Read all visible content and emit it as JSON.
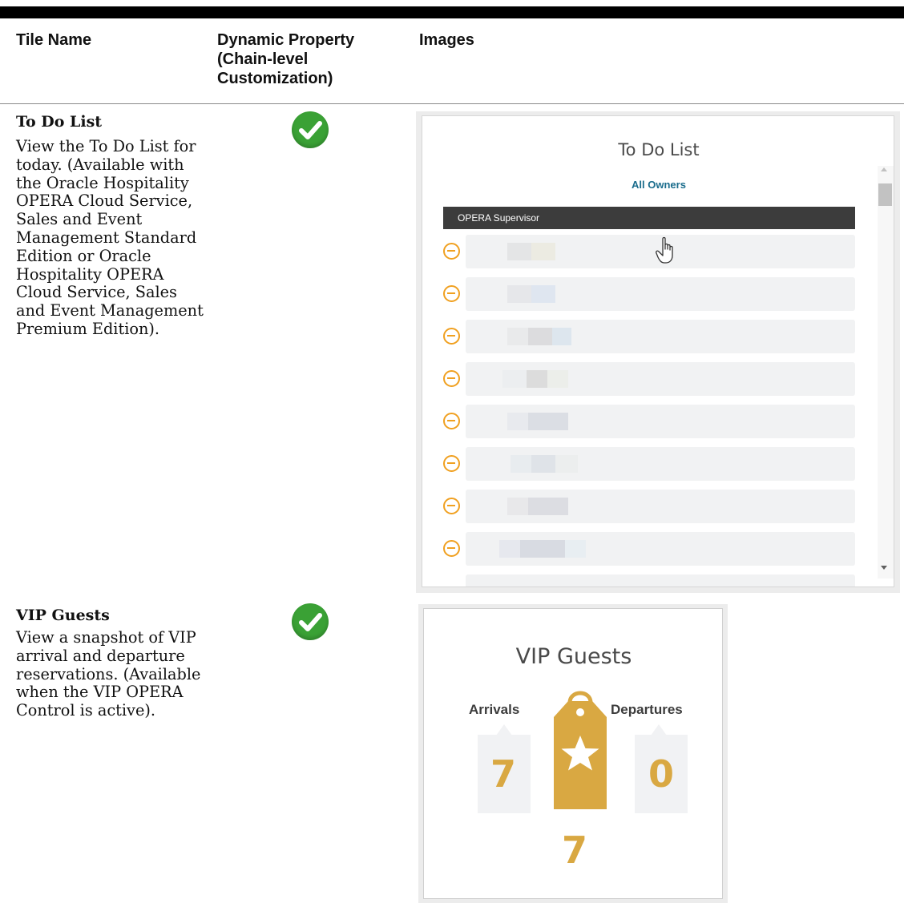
{
  "table": {
    "headers": {
      "tile_name": "Tile Name",
      "dynamic_property": "Dynamic Property (Chain-level Customization)",
      "images": "Images"
    },
    "rows": [
      {
        "title": "To Do List",
        "description": "View the To Do List for today. (Available with the Oracle Hospitality OPERA Cloud Service, Sales and Event Management Standard Edition or Oracle Hospitality OPERA Cloud Service, Sales and Event Management Premium Edition).",
        "dynamic_property": true
      },
      {
        "title": "VIP Guests",
        "description": "View a snapshot of VIP arrival and departure reservations. (Available when the VIP OPERA Control is active).",
        "dynamic_property": true
      }
    ]
  },
  "todo_tile": {
    "title": "To Do List",
    "owner_filter": "All Owners",
    "group_header": "OPERA Supervisor",
    "item_count_visible": 8,
    "item_icon": "minus-circle-icon"
  },
  "vip_tile": {
    "title": "VIP Guests",
    "arrivals_label": "Arrivals",
    "arrivals_count": "7",
    "departures_label": "Departures",
    "departures_count": "0",
    "total_count": "7"
  },
  "colors": {
    "check_green": "#3aa135",
    "todo_icon_orange": "#f0a020",
    "vip_gold": "#d9a842",
    "group_header_bg": "#3c3c3c"
  }
}
